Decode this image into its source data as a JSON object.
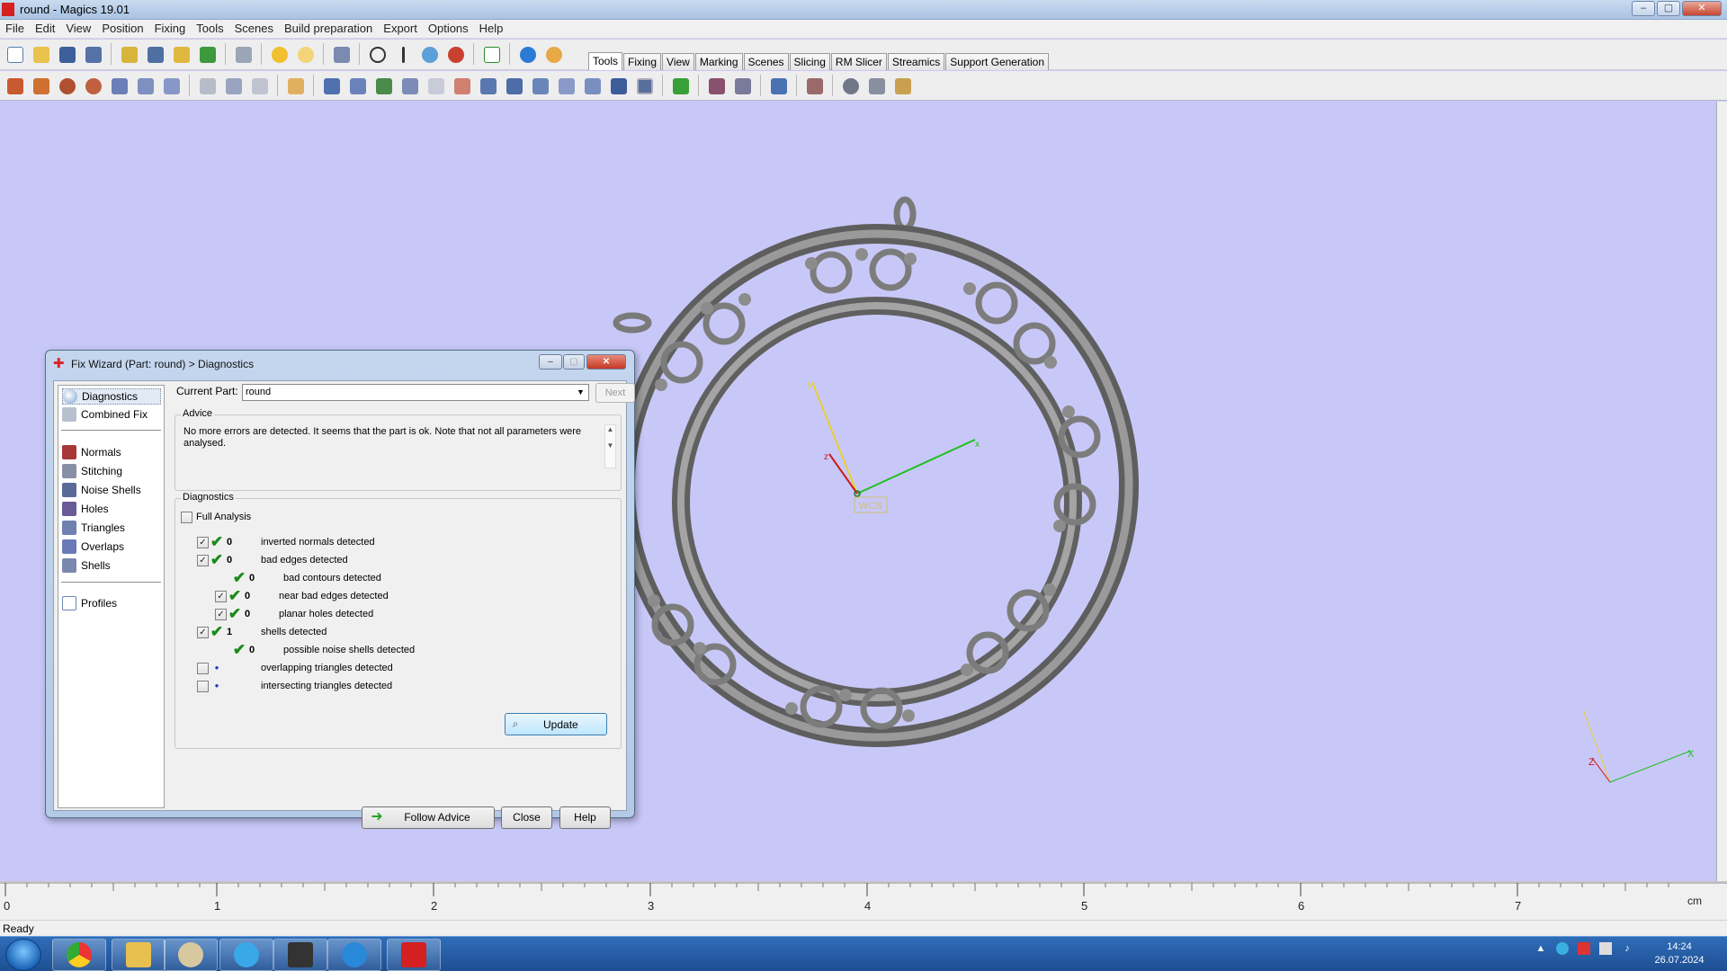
{
  "window": {
    "title": "round - Magics 19.01",
    "min": "–",
    "max": "▢",
    "close": "✕"
  },
  "menu": [
    "File",
    "Edit",
    "View",
    "Position",
    "Fixing",
    "Tools",
    "Scenes",
    "Build preparation",
    "Export",
    "Options",
    "Help"
  ],
  "tabs": [
    "Tools",
    "Fixing",
    "View",
    "Marking",
    "Scenes",
    "Slicing",
    "RM Slicer",
    "Streamics",
    "Support Generation"
  ],
  "active_tab": "Tools",
  "viewport": {
    "wcs_label": "WCS",
    "axis_x": "x",
    "axis_y": "y",
    "axis_z": "z",
    "mini_z": "Z",
    "mini_x": "X"
  },
  "ruler": {
    "labels": [
      "0",
      "1",
      "2",
      "3",
      "4",
      "5",
      "6",
      "7"
    ],
    "unit": "cm"
  },
  "status": {
    "text": "Ready"
  },
  "dialog": {
    "title": "Fix Wizard (Part: round) > Diagnostics",
    "nav_top": [
      "Diagnostics",
      "Combined Fix"
    ],
    "nav_tools": [
      "Normals",
      "Stitching",
      "Noise Shells",
      "Holes",
      "Triangles",
      "Overlaps",
      "Shells"
    ],
    "nav_bottom": [
      "Profiles"
    ],
    "current_part_label": "Current Part:",
    "current_part_value": "round",
    "next_label": "Next",
    "advice_label": "Advice",
    "advice_text": "No more errors are detected. It seems that the part is ok. Note that not all parameters were analysed.",
    "diagnostics_label": "Diagnostics",
    "full_analysis_label": "Full Analysis",
    "rows": [
      {
        "count": "0",
        "label": "inverted normals detected"
      },
      {
        "count": "0",
        "label": "bad edges detected"
      },
      {
        "count": "0",
        "label": "bad contours detected"
      },
      {
        "count": "0",
        "label": "near bad edges detected"
      },
      {
        "count": "0",
        "label": "planar holes detected"
      },
      {
        "count": "1",
        "label": "shells detected"
      },
      {
        "count": "0",
        "label": "possible noise shells detected"
      },
      {
        "count": "",
        "label": "overlapping triangles detected"
      },
      {
        "count": "",
        "label": "intersecting triangles detected"
      }
    ],
    "update_label": "Update",
    "follow_advice_label": "Follow Advice",
    "close_label": "Close",
    "help_label": "Help"
  },
  "taskbar": {
    "time": "14:24",
    "date": "26.07.2024"
  },
  "colors": {
    "viewport_bg": "#c8c8f8",
    "part_gray": "#8a8a8a",
    "axis_x": "#1fbf1f",
    "axis_y": "#e8d030",
    "axis_z": "#d01818"
  }
}
